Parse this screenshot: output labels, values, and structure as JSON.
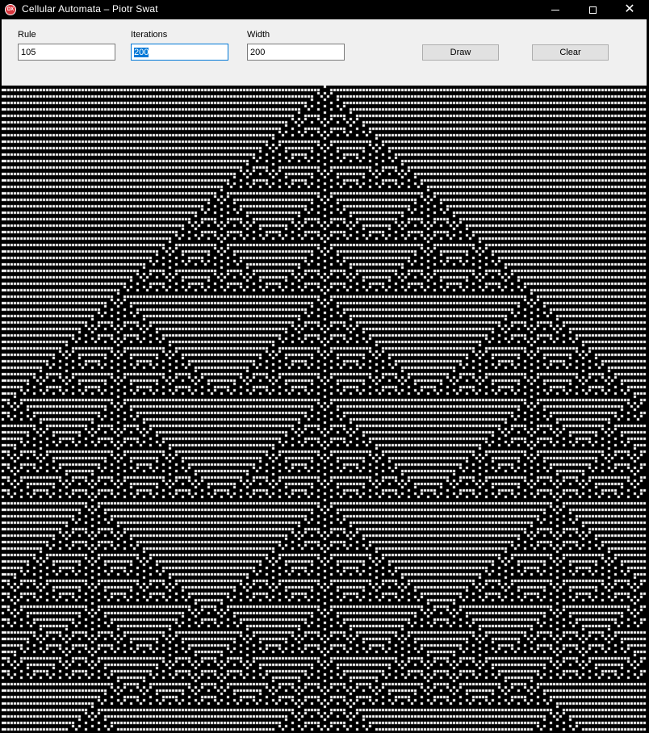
{
  "window": {
    "title": "Cellular Automata – Piotr Swat",
    "icon_label": "DX",
    "close_glyph": "✕"
  },
  "form": {
    "rule_label": "Rule",
    "rule_value": "105",
    "iterations_label": "Iterations",
    "iterations_value": "200",
    "width_label": "Width",
    "width_value": "200",
    "draw_label": "Draw",
    "clear_label": "Clear"
  },
  "automaton": {
    "rule": 105,
    "iterations": 200,
    "width": 200,
    "on_color": "#ffffff",
    "off_color": "#000000"
  },
  "colors": {
    "titlebar": "#000000",
    "toolbar": "#f0f0f0",
    "focus": "#0078d7"
  }
}
